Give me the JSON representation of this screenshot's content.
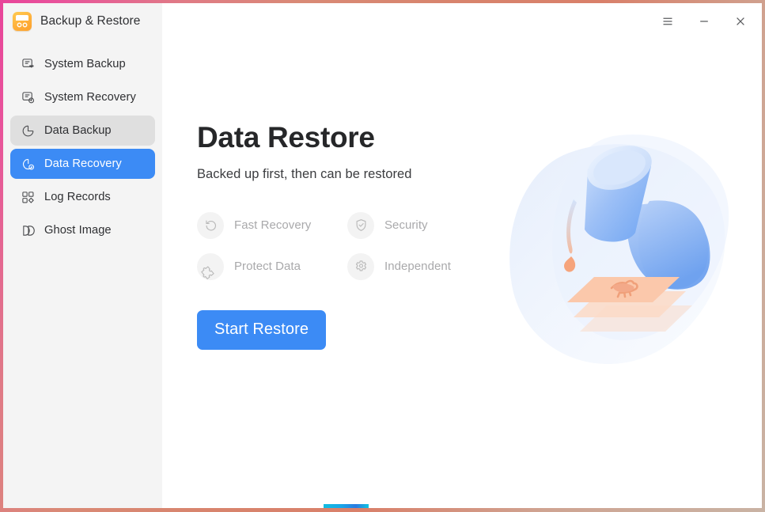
{
  "window": {
    "brand_title": "Backup & Restore",
    "app_icon": "backup-app-icon",
    "controls": [
      {
        "name": "menu-button",
        "icon": "hamburger-menu-icon",
        "label": "☰"
      },
      {
        "name": "minimize-button",
        "icon": "minimize-icon",
        "label": "−"
      },
      {
        "name": "close-button",
        "icon": "close-icon",
        "label": "✕"
      }
    ],
    "border_colors": {
      "top_left": "#e8449a",
      "top_right": "#d8846d",
      "bottom_left": "#e8449a",
      "bottom_right": "#c9b3a4",
      "accent_strip": "#11bde0"
    }
  },
  "sidebar": {
    "background": "#f4f4f4",
    "items": [
      {
        "label": "System Backup",
        "icon": "system-backup-icon",
        "state": "normal"
      },
      {
        "label": "System Recovery",
        "icon": "system-recovery-icon",
        "state": "normal"
      },
      {
        "label": "Data Backup",
        "icon": "data-backup-icon",
        "state": "hovered"
      },
      {
        "label": "Data Recovery",
        "icon": "data-recovery-icon",
        "state": "active"
      },
      {
        "label": "Log Records",
        "icon": "log-records-icon",
        "state": "normal"
      },
      {
        "label": "Ghost Image",
        "icon": "ghost-image-icon",
        "state": "normal"
      }
    ]
  },
  "main": {
    "title": "Data Restore",
    "subtitle": "Backed up first, then can be restored",
    "features": [
      {
        "label": "Fast Recovery",
        "icon": "undo-arrow-icon"
      },
      {
        "label": "Security",
        "icon": "shield-check-icon"
      },
      {
        "label": "Protect Data",
        "icon": "puzzle-piece-icon"
      },
      {
        "label": "Independent",
        "icon": "gear-icon"
      }
    ],
    "primary_button": "Start Restore",
    "accent_color": "#3c8bf5",
    "illustration": "pouring-vessel-onto-layers-illustration"
  }
}
